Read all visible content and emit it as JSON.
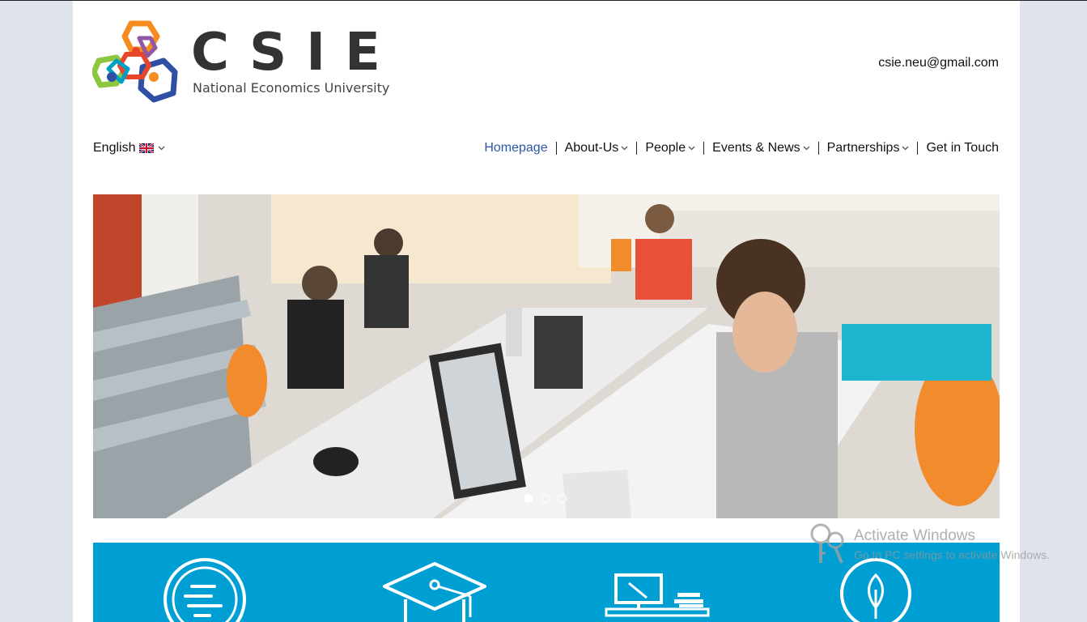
{
  "brand": {
    "name": "CSIE",
    "subtitle": "National Economics University",
    "colors": {
      "orange": "#f68b1f",
      "red": "#e8462b",
      "green": "#8dc63f",
      "blue": "#2e4fa3",
      "teal": "#00a0c6",
      "text": "#333333"
    }
  },
  "header": {
    "email": "csie.neu@gmail.com"
  },
  "language": {
    "label": "English",
    "flag_icon": "uk-flag-icon"
  },
  "nav": {
    "items": [
      {
        "label": "Homepage",
        "active": true,
        "dropdown": false
      },
      {
        "label": "About-Us",
        "active": false,
        "dropdown": true
      },
      {
        "label": "People",
        "active": false,
        "dropdown": true
      },
      {
        "label": "Events & News",
        "active": false,
        "dropdown": true
      },
      {
        "label": "Partnerships",
        "active": false,
        "dropdown": true
      },
      {
        "label": "Get in Touch",
        "active": false,
        "dropdown": false
      }
    ],
    "active_color": "#2b56a6"
  },
  "hero": {
    "image": "students-working-at-computers-in-open-office",
    "slide_count": 3,
    "active_slide": 1
  },
  "features": {
    "background_color": "#009fd3",
    "icons": [
      "text-lines-circle-icon",
      "graduation-cap-icon",
      "computer-desk-icon",
      "leaf-circle-icon"
    ]
  },
  "windows_watermark": {
    "title": "Activate Windows",
    "subtitle": "Go to PC settings to activate Windows."
  }
}
